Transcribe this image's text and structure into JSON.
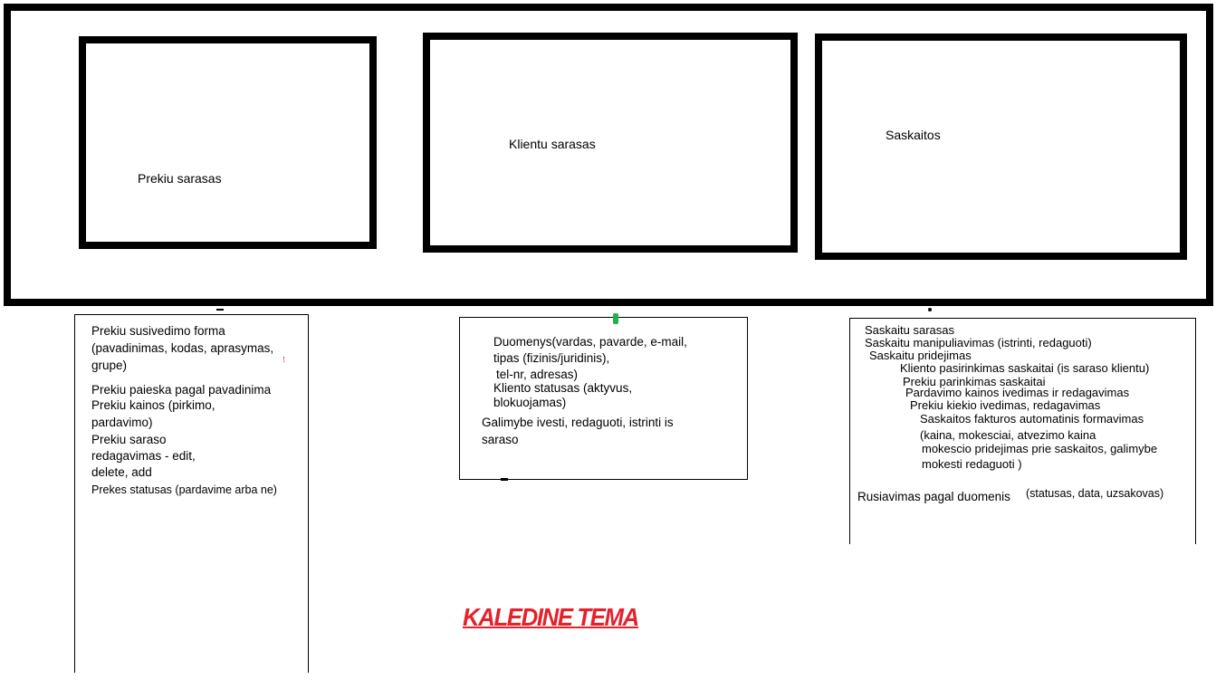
{
  "modules": {
    "prekes": {
      "label": "Prekiu sarasas"
    },
    "klientai": {
      "label": "Klientu sarasas"
    },
    "saskaitos": {
      "label": "Saskaitos"
    }
  },
  "panels": {
    "prekes": {
      "lines": [
        "Prekiu susivedimo forma",
        "(pavadinimas, kodas, aprasymas,",
        "grupe)",
        "Prekiu paieska pagal pavadinima",
        "Prekiu kainos (pirkimo,",
        "pardavimo)",
        "Prekiu saraso",
        "redagavimas - edit,",
        "delete, add",
        "Prekes statusas (pardavime arba ne)"
      ]
    },
    "klientai": {
      "lines": [
        "Duomenys(vardas, pavarde, e-mail,",
        "tipas (fizinis/juridinis),",
        "tel-nr, adresas)",
        "Kliento statusas (aktyvus,",
        "blokuojamas)",
        "Galimybe ivesti, redaguoti, istrinti is",
        "saraso"
      ]
    },
    "saskaitos": {
      "lines": [
        "Saskaitu sarasas",
        "Saskaitu manipuliavimas (istrinti, redaguoti)",
        "Saskaitu pridejimas",
        "Kliento pasirinkimas saskaitai (is saraso klientu)",
        "Prekiu parinkimas saskaitai",
        "Pardavimo kainos ivedimas ir redagavimas",
        "Prekiu kiekio ivedimas, redagavimas",
        "Saskaitos fakturos automatinis formavimas",
        "(kaina, mokesciai, atvezimo kaina",
        "mokescio pridejimas prie saskaitos, galimybe",
        "mokesti redaguoti )",
        "Rusiavimas pagal duomenis",
        "(statusas, data, uzsakovas)"
      ]
    }
  },
  "theme": {
    "label": "KALEDINE TEMA",
    "color": "#e5212b"
  },
  "colors": {
    "accent_mark": "#22b14c",
    "dot_mark": "#e5212b"
  }
}
